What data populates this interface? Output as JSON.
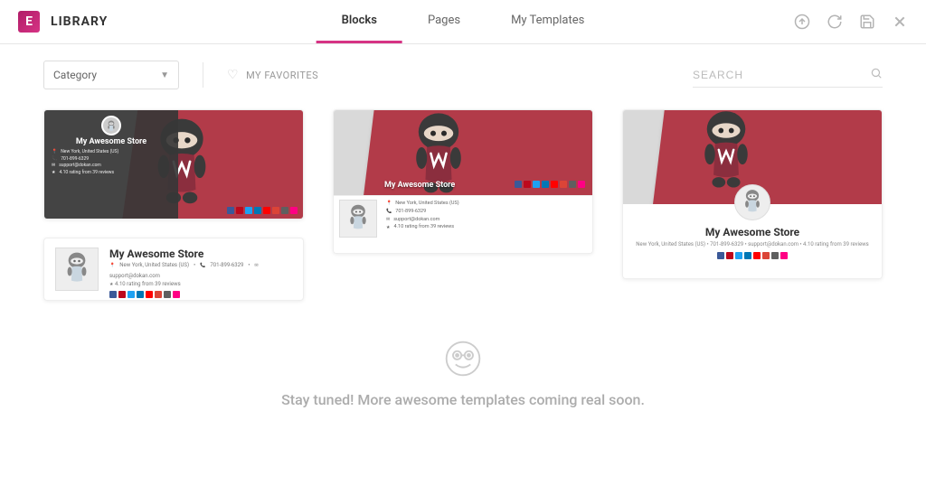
{
  "header": {
    "logo_letter": "E",
    "title": "LIBRARY",
    "tabs": {
      "blocks": "Blocks",
      "pages": "Pages",
      "myTemplates": "My Templates"
    }
  },
  "toolbar": {
    "category_label": "Category",
    "favorites_label": "MY FAVORITES",
    "search_placeholder": "SEARCH"
  },
  "store": {
    "name": "My Awesome Store",
    "location": "New York, United States (US)",
    "phone": "701-899-6329",
    "email": "support@dokan.com",
    "rating": "4.10 rating from 39 reviews"
  },
  "cards": {
    "card3_meta_line": "New York, United States (US) • 701-899-6329 • support@dokan.com • 4.10 rating from 39 reviews"
  },
  "footer": {
    "message": "Stay tuned! More awesome templates coming real soon."
  }
}
